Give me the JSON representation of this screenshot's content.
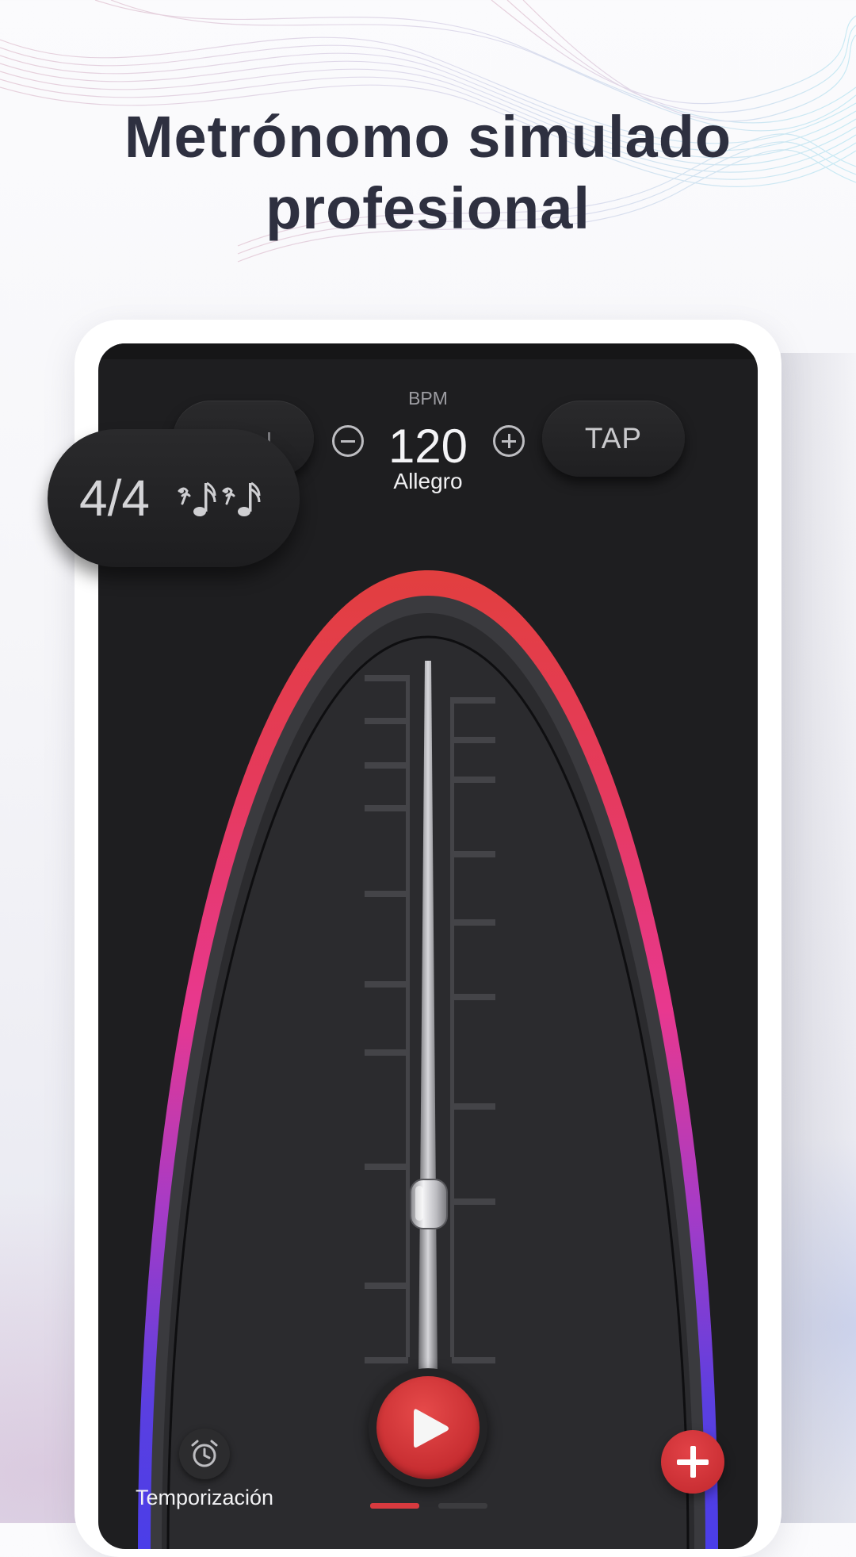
{
  "headline": {
    "line1": "Metrónomo simulado",
    "line2": "profesional"
  },
  "header": {
    "bpm_label": "BPM",
    "bpm_value": "120",
    "tempo_name": "Allegro",
    "tap_label": "TAP",
    "decrease_icon": "minus-circle-icon",
    "increase_icon": "plus-circle-icon"
  },
  "time_signature": {
    "label": "4/4",
    "pattern_icon": "rest-and-sixteenth-notes-icon"
  },
  "metronome": {
    "accent_colors": [
      "#e23f3f",
      "#e8388f",
      "#5b3fe0"
    ],
    "weight_position": 0.82
  },
  "controls": {
    "play_icon": "play-icon",
    "timer_icon": "alarm-clock-icon",
    "timer_label": "Temporización",
    "add_icon": "plus-icon",
    "page_indicator": {
      "count": 2,
      "active": 0
    }
  }
}
